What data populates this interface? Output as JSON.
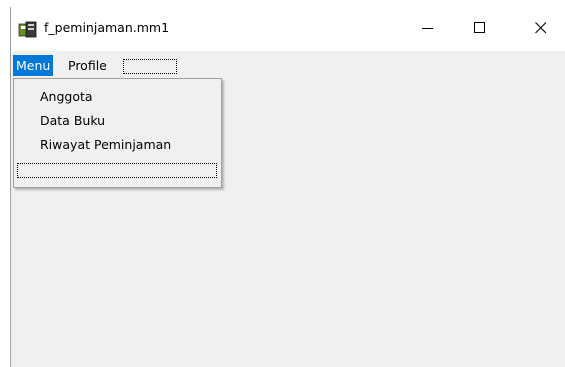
{
  "window": {
    "title": "f_peminjaman.mm1",
    "icon": "app-icon",
    "controls": [
      "minimize-icon",
      "maximize-icon",
      "close-icon"
    ]
  },
  "menubar": {
    "items": [
      {
        "label": "Menu",
        "active": true
      },
      {
        "label": "Profile",
        "active": false
      },
      {
        "label": "",
        "placeholder": true
      }
    ]
  },
  "dropdown": {
    "items": [
      {
        "label": "Anggota"
      },
      {
        "label": "Data Buku"
      },
      {
        "label": "Riwayat Peminjaman"
      },
      {
        "label": "",
        "placeholder": true
      }
    ]
  },
  "colors": {
    "highlight": "#0078d7",
    "client_bg": "#f0f0f0",
    "titlebar_bg": "#ffffff"
  }
}
